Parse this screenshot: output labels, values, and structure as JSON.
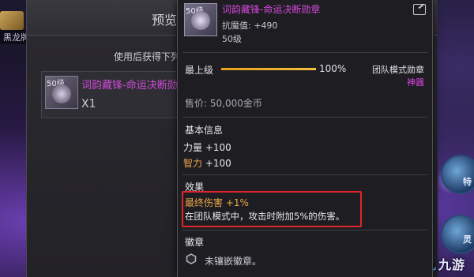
{
  "background": {
    "left_tag": "黑龙牌",
    "right_labels": [
      "特",
      "灵"
    ],
    "watermark_icon": "九",
    "watermark_text": "九游"
  },
  "preview": {
    "title": "预览",
    "description": "使用后获得下列",
    "item": {
      "level_badge": "50级",
      "name": "词韵藏锋-命运决断勋章",
      "quantity": "X1"
    }
  },
  "tooltip": {
    "level_badge": "50级",
    "name": "词韵藏锋-命运决断勋章",
    "stat_label": "抗魔值:",
    "stat_value": "+490",
    "level": "50级",
    "max_level_label": "最上级",
    "progress": 1.0,
    "progress_text": "100%",
    "item_type": "团队模式勋章",
    "rarity": "神器",
    "price": "售价: 50,000金币",
    "basic_info_title": "基本信息",
    "basic_stats": [
      {
        "key": "力量",
        "value": "+100",
        "key_color": "white"
      },
      {
        "key": "智力",
        "value": "+100",
        "key_color": "orange"
      }
    ],
    "effect_title": "效果",
    "effect_line1": "最终伤害 +1%",
    "effect_line2": "在团队模式中，攻击时附加5%的伤害。",
    "badge_title": "徽章",
    "badge_text": "未镶嵌徽章。"
  },
  "colors": {
    "item_name": "#d648dc",
    "effect_highlight": "#f0a64a",
    "effect_border": "#e0252a",
    "progress_fill": "#f2c040"
  }
}
